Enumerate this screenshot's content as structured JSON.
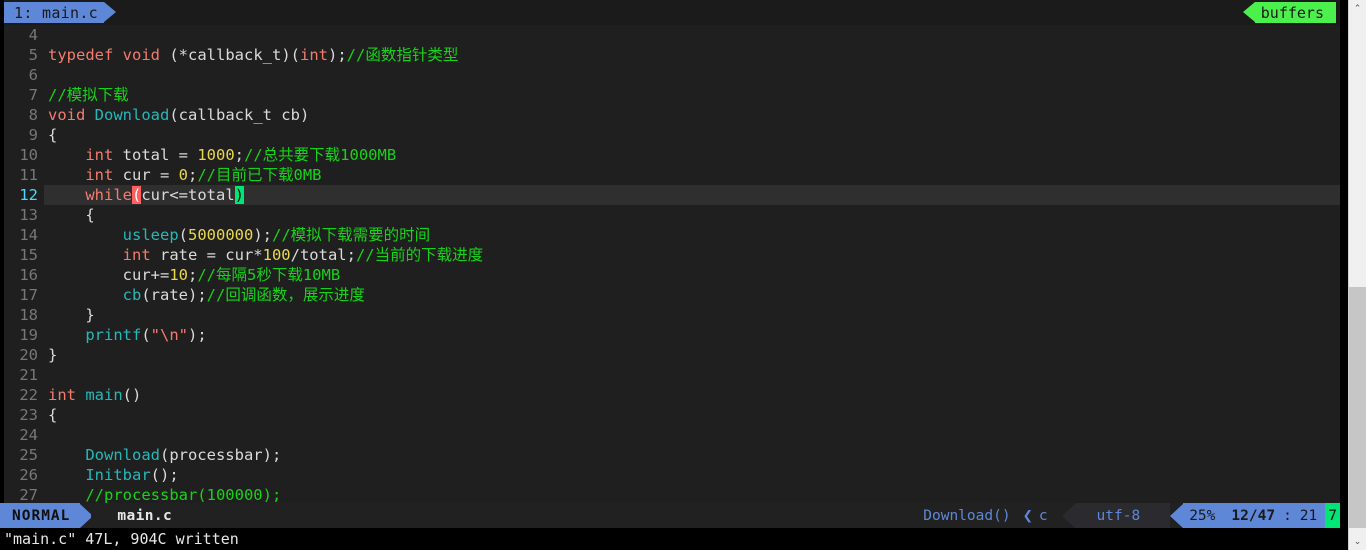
{
  "tabline": {
    "tab_label": "1: main.c",
    "buffers_label": "buffers",
    "tab_bg": "#5f87d7",
    "buffers_bg": "#4cf04c"
  },
  "editor": {
    "first_visible_line": 4,
    "cursor_line": 12,
    "lines": [
      {
        "num": "4",
        "segments": []
      },
      {
        "num": "5",
        "segments": [
          {
            "t": "typedef",
            "c": "k"
          },
          {
            "t": " ",
            "c": "id"
          },
          {
            "t": "void",
            "c": "k"
          },
          {
            "t": " (*callback_t)(",
            "c": "id"
          },
          {
            "t": "int",
            "c": "k"
          },
          {
            "t": ");",
            "c": "id"
          },
          {
            "t": "//函数指针类型",
            "c": "cm"
          }
        ]
      },
      {
        "num": "6",
        "segments": []
      },
      {
        "num": "7",
        "segments": [
          {
            "t": "//模拟下载",
            "c": "cm"
          }
        ]
      },
      {
        "num": "8",
        "segments": [
          {
            "t": "void",
            "c": "k"
          },
          {
            "t": " ",
            "c": "id"
          },
          {
            "t": "Download",
            "c": "fn"
          },
          {
            "t": "(callback_t cb)",
            "c": "id"
          }
        ]
      },
      {
        "num": "9",
        "segments": [
          {
            "t": "{",
            "c": "id"
          }
        ]
      },
      {
        "num": "10",
        "segments": [
          {
            "t": "    ",
            "c": "id"
          },
          {
            "t": "int",
            "c": "k"
          },
          {
            "t": " total = ",
            "c": "id"
          },
          {
            "t": "1000",
            "c": "nm"
          },
          {
            "t": ";",
            "c": "id"
          },
          {
            "t": "//总共要下载1000MB",
            "c": "cm"
          }
        ]
      },
      {
        "num": "11",
        "segments": [
          {
            "t": "    ",
            "c": "id"
          },
          {
            "t": "int",
            "c": "k"
          },
          {
            "t": " cur = ",
            "c": "id"
          },
          {
            "t": "0",
            "c": "nm"
          },
          {
            "t": ";",
            "c": "id"
          },
          {
            "t": "//目前已下载0MB",
            "c": "cm"
          }
        ]
      },
      {
        "num": "12",
        "segments": [
          {
            "t": "    ",
            "c": "id"
          },
          {
            "t": "while",
            "c": "k"
          },
          {
            "t": "(",
            "c": "mp-open"
          },
          {
            "t": "cur<=total",
            "c": "id"
          },
          {
            "t": ")",
            "c": "mp-close"
          }
        ]
      },
      {
        "num": "13",
        "segments": [
          {
            "t": "    {",
            "c": "id"
          }
        ]
      },
      {
        "num": "14",
        "segments": [
          {
            "t": "        ",
            "c": "id"
          },
          {
            "t": "usleep",
            "c": "fn"
          },
          {
            "t": "(",
            "c": "id"
          },
          {
            "t": "5000000",
            "c": "nm"
          },
          {
            "t": ");",
            "c": "id"
          },
          {
            "t": "//模拟下载需要的时间",
            "c": "cm"
          }
        ]
      },
      {
        "num": "15",
        "segments": [
          {
            "t": "        ",
            "c": "id"
          },
          {
            "t": "int",
            "c": "k"
          },
          {
            "t": " rate = cur*",
            "c": "id"
          },
          {
            "t": "100",
            "c": "nm"
          },
          {
            "t": "/total;",
            "c": "id"
          },
          {
            "t": "//当前的下载进度",
            "c": "cm"
          }
        ]
      },
      {
        "num": "16",
        "segments": [
          {
            "t": "        cur+=",
            "c": "id"
          },
          {
            "t": "10",
            "c": "nm"
          },
          {
            "t": ";",
            "c": "id"
          },
          {
            "t": "//每隔5秒下载10MB",
            "c": "cm"
          }
        ]
      },
      {
        "num": "17",
        "segments": [
          {
            "t": "        ",
            "c": "id"
          },
          {
            "t": "cb",
            "c": "fn"
          },
          {
            "t": "(rate);",
            "c": "id"
          },
          {
            "t": "//回调函数，展示进度",
            "c": "cm"
          }
        ]
      },
      {
        "num": "18",
        "segments": [
          {
            "t": "    }",
            "c": "id"
          }
        ]
      },
      {
        "num": "19",
        "segments": [
          {
            "t": "    ",
            "c": "id"
          },
          {
            "t": "printf",
            "c": "fn"
          },
          {
            "t": "(",
            "c": "id"
          },
          {
            "t": "\"\\n\"",
            "c": "st"
          },
          {
            "t": ");",
            "c": "id"
          }
        ]
      },
      {
        "num": "20",
        "segments": [
          {
            "t": "}",
            "c": "id"
          }
        ]
      },
      {
        "num": "21",
        "segments": []
      },
      {
        "num": "22",
        "segments": [
          {
            "t": "int",
            "c": "k"
          },
          {
            "t": " ",
            "c": "id"
          },
          {
            "t": "main",
            "c": "fn"
          },
          {
            "t": "()",
            "c": "id"
          }
        ]
      },
      {
        "num": "23",
        "segments": [
          {
            "t": "{",
            "c": "id"
          }
        ]
      },
      {
        "num": "24",
        "segments": []
      },
      {
        "num": "25",
        "segments": [
          {
            "t": "    ",
            "c": "id"
          },
          {
            "t": "Download",
            "c": "fn"
          },
          {
            "t": "(processbar);",
            "c": "id"
          }
        ]
      },
      {
        "num": "26",
        "segments": [
          {
            "t": "    ",
            "c": "id"
          },
          {
            "t": "Initbar",
            "c": "fn"
          },
          {
            "t": "();",
            "c": "id"
          }
        ]
      },
      {
        "num": "27",
        "segments": [
          {
            "t": "    ",
            "c": "id"
          },
          {
            "t": "//processbar(100000);",
            "c": "cm"
          }
        ]
      }
    ]
  },
  "statusline": {
    "mode": "NORMAL",
    "filename": "main.c",
    "function": "Download()",
    "chevron": "❮",
    "filetype": "c",
    "encoding": "utf-8",
    "percent": "25%",
    "line_total": "12/47",
    "separator": ":",
    "column": "21",
    "virtual_column": "7"
  },
  "cmdline": {
    "message": "\"main.c\" 47L, 904C written"
  },
  "scrollbar": {
    "up_arrow": "⌃",
    "down_arrow": "⌄"
  }
}
